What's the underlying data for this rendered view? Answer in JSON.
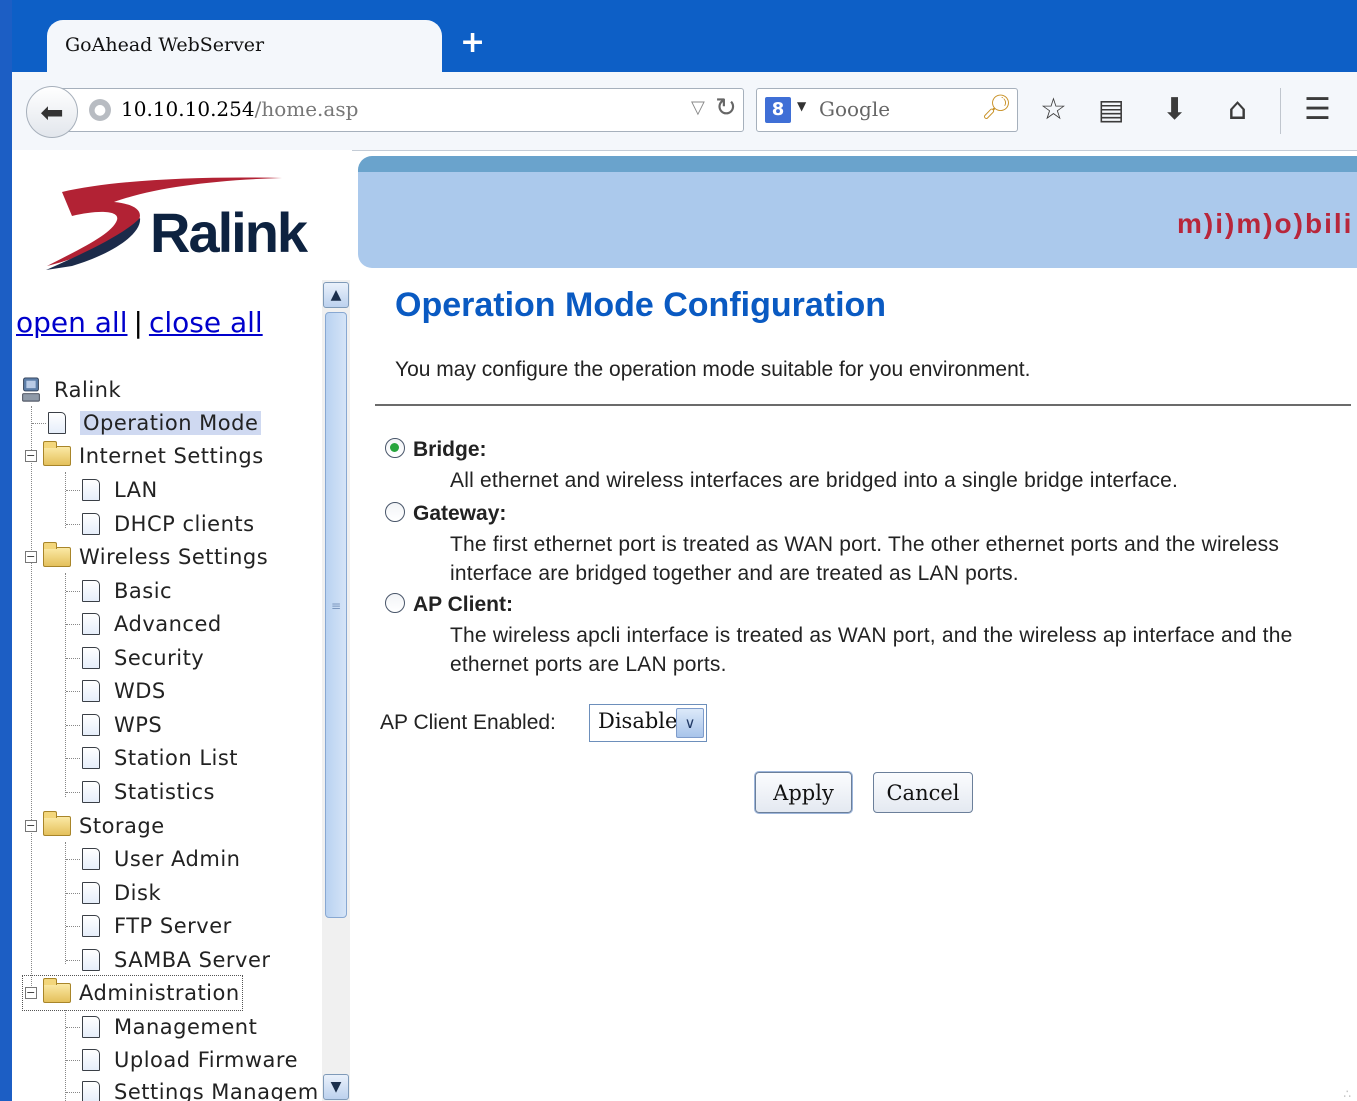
{
  "browser": {
    "tab_title": "GoAhead WebServer",
    "new_tab_symbol": "+",
    "url_host": "10.10.10.254",
    "url_path": "/home.asp",
    "search_placeholder": "Google",
    "search_engine_icon": "google-g-icon"
  },
  "header": {
    "logo_text": "Ralink",
    "banner_text": "m)i)m)o)bili"
  },
  "tree": {
    "open_all": "open all",
    "separator": "|",
    "close_all": "close all",
    "root": "Ralink",
    "items": [
      {
        "label": "Operation Mode",
        "type": "page",
        "level": 1
      },
      {
        "label": "Internet Settings",
        "type": "folder",
        "level": 1
      },
      {
        "label": "LAN",
        "type": "page",
        "level": 2
      },
      {
        "label": "DHCP clients",
        "type": "page",
        "level": 2
      },
      {
        "label": "Wireless Settings",
        "type": "folder",
        "level": 1
      },
      {
        "label": "Basic",
        "type": "page",
        "level": 2
      },
      {
        "label": "Advanced",
        "type": "page",
        "level": 2
      },
      {
        "label": "Security",
        "type": "page",
        "level": 2
      },
      {
        "label": "WDS",
        "type": "page",
        "level": 2
      },
      {
        "label": "WPS",
        "type": "page",
        "level": 2
      },
      {
        "label": "Station List",
        "type": "page",
        "level": 2
      },
      {
        "label": "Statistics",
        "type": "page",
        "level": 2
      },
      {
        "label": "Storage",
        "type": "folder",
        "level": 1
      },
      {
        "label": "User Admin",
        "type": "page",
        "level": 2
      },
      {
        "label": "Disk",
        "type": "page",
        "level": 2
      },
      {
        "label": "FTP Server",
        "type": "page",
        "level": 2
      },
      {
        "label": "SAMBA Server",
        "type": "page",
        "level": 2
      },
      {
        "label": "Administration",
        "type": "folder",
        "level": 1
      },
      {
        "label": "Management",
        "type": "page",
        "level": 2
      },
      {
        "label": "Upload Firmware",
        "type": "page",
        "level": 2
      },
      {
        "label": "Settings Managem",
        "type": "page",
        "level": 2
      }
    ]
  },
  "main": {
    "title": "Operation Mode Configuration",
    "description": "You may configure the operation mode suitable for you environment.",
    "modes": [
      {
        "label": "Bridge:",
        "checked": true,
        "description": "All ethernet and wireless interfaces are bridged into a single bridge interface."
      },
      {
        "label": "Gateway:",
        "checked": false,
        "description": "The first ethernet port is treated as WAN port. The other ethernet ports and the wireless interface are bridged together and are treated as LAN ports."
      },
      {
        "label": "AP Client:",
        "checked": false,
        "description": "The wireless apcli interface is treated as WAN port, and the wireless ap interface and the ethernet ports are LAN ports."
      }
    ],
    "ap_client_label": "AP Client Enabled:",
    "ap_client_value": "Disable",
    "apply_label": "Apply",
    "cancel_label": "Cancel"
  },
  "colors": {
    "title_blue": "#0a5ac2",
    "link_blue": "#0000cc",
    "banner_blue": "#abc9ec",
    "tabbar_blue": "#0d5fc6",
    "radio_green": "#27a53d"
  }
}
